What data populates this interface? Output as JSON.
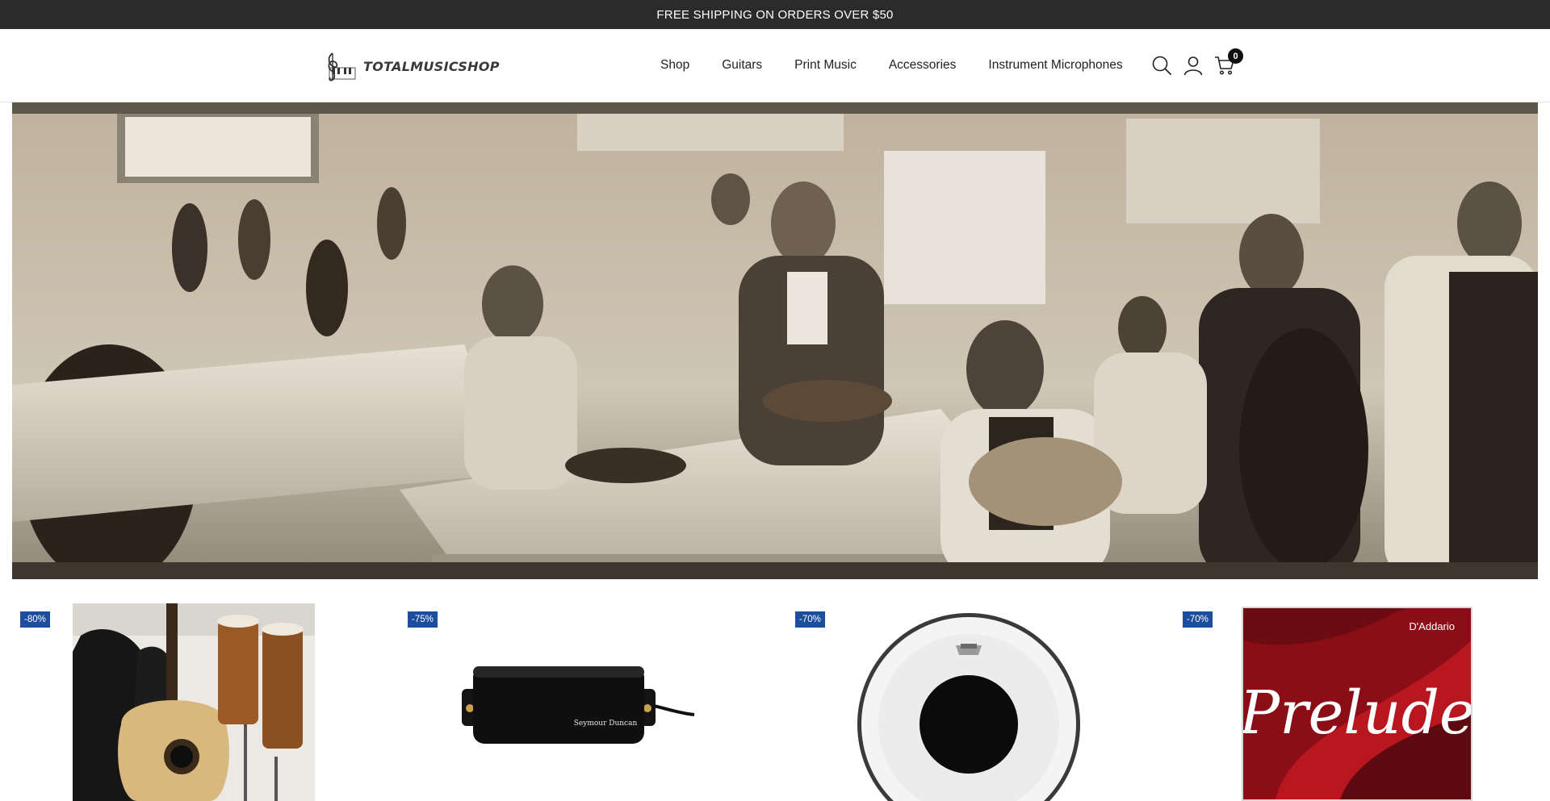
{
  "announcement": {
    "text": "FREE SHIPPING ON ORDERS OVER $50"
  },
  "header": {
    "logo_text": "TOTALMUSICSHOP",
    "nav": [
      {
        "label": "Shop"
      },
      {
        "label": "Guitars"
      },
      {
        "label": "Print Music"
      },
      {
        "label": "Accessories"
      },
      {
        "label": "Instrument Microphones"
      }
    ],
    "icons": {
      "search": "search-icon",
      "account": "user-icon",
      "cart": "cart-icon"
    },
    "cart_count": "0"
  },
  "hero": {
    "image": "sepia photograph of violin makers workshop"
  },
  "products": [
    {
      "discount": "-80%",
      "image": "guitars and percussion in store"
    },
    {
      "discount": "-75%",
      "image": "black humbucker pickup",
      "pickup_brand": "Seymour Duncan"
    },
    {
      "discount": "-70%",
      "image": "coated drum head with black dot"
    },
    {
      "discount": "-70%",
      "image": "string set package",
      "package_brand": "D'Addario",
      "package_title": "Prelude"
    }
  ],
  "colors": {
    "announce_bg": "#2b2b2b",
    "badge_bg": "#1d4e9e",
    "prelude_red": "#b0141e"
  }
}
